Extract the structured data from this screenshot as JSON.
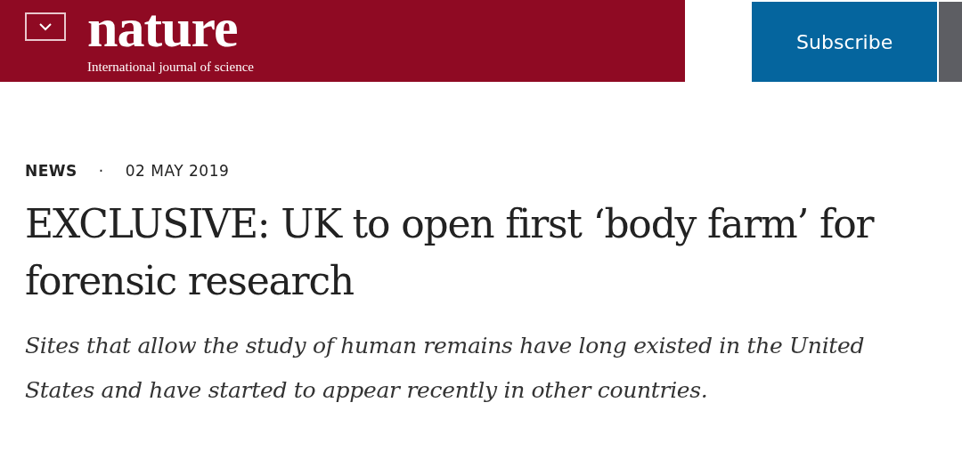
{
  "header": {
    "logo": "nature",
    "tagline": "International journal of science",
    "subscribe": "Subscribe"
  },
  "article": {
    "category": "NEWS",
    "separator": "·",
    "date": "02 MAY 2019",
    "title": "EXCLUSIVE: UK to open first ‘body farm’ for forensic research",
    "standfirst": "Sites that allow the study of human remains have long existed in the United States and have started to appear recently in other countries."
  }
}
